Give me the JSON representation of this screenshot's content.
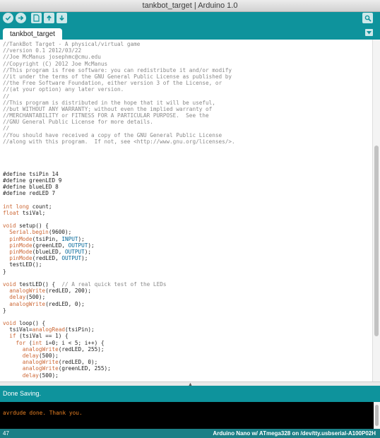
{
  "window": {
    "title": "tankbot_target | Arduino 1.0"
  },
  "toolbar": {
    "buttons": [
      {
        "name": "verify",
        "icon": "check-icon"
      },
      {
        "name": "upload",
        "icon": "arrow-right-icon"
      },
      {
        "name": "new",
        "icon": "document-icon"
      },
      {
        "name": "open",
        "icon": "arrow-up-icon"
      },
      {
        "name": "save",
        "icon": "arrow-down-icon"
      }
    ],
    "serial_monitor_icon": "magnifier-icon"
  },
  "tabs": [
    {
      "label": "tankbot_target",
      "active": true
    }
  ],
  "editor": {
    "lines": [
      {
        "type": "comment",
        "text": "//TankBot Target - A physical/virtual game"
      },
      {
        "type": "comment",
        "text": "//version 0.1 2012/03/22"
      },
      {
        "type": "comment",
        "text": "//Joe McManus josephmc@cmu.edu"
      },
      {
        "type": "comment",
        "text": "//Copyright (C) 2012 Joe McManus"
      },
      {
        "type": "comment",
        "text": "//This program is free software: you can redistribute it and/or modify"
      },
      {
        "type": "comment",
        "text": "//it under the terms of the GNU General Public License as published by"
      },
      {
        "type": "comment",
        "text": "//the Free Software Foundation, either version 3 of the License, or"
      },
      {
        "type": "comment",
        "text": "//(at your option) any later version."
      },
      {
        "type": "comment",
        "text": "//"
      },
      {
        "type": "comment",
        "text": "//This program is distributed in the hope that it will be useful,"
      },
      {
        "type": "comment",
        "text": "//but WITHOUT ANY WARRANTY; without even the implied warranty of"
      },
      {
        "type": "comment",
        "text": "//MERCHANTABILITY or FITNESS FOR A PARTICULAR PURPOSE.  See the"
      },
      {
        "type": "comment",
        "text": "//GNU General Public License for more details."
      },
      {
        "type": "comment",
        "text": "//"
      },
      {
        "type": "comment",
        "text": "//You should have received a copy of the GNU General Public License"
      },
      {
        "type": "comment",
        "text": "//along with this program.  If not, see <http://www.gnu.org/licenses/>."
      },
      {
        "type": "blank",
        "text": ""
      },
      {
        "type": "blank",
        "text": ""
      },
      {
        "type": "blank",
        "text": ""
      },
      {
        "type": "blank",
        "text": ""
      },
      {
        "type": "plain",
        "text": "#define tsiPin 14"
      },
      {
        "type": "plain",
        "text": "#define greenLED 9"
      },
      {
        "type": "plain",
        "text": "#define blueLED 8"
      },
      {
        "type": "plain",
        "text": "#define redLED 7"
      },
      {
        "type": "blank",
        "text": ""
      },
      {
        "type": "plain",
        "text": "int long count;"
      },
      {
        "type": "plain",
        "text": "float tsiVal;"
      },
      {
        "type": "blank",
        "text": ""
      },
      {
        "type": "plain",
        "text": "void setup() {"
      },
      {
        "type": "plain",
        "text": "  Serial.begin(9600);"
      },
      {
        "type": "plain",
        "text": "  pinMode(tsiPin, INPUT);"
      },
      {
        "type": "plain",
        "text": "  pinMode(greenLED, OUTPUT);"
      },
      {
        "type": "plain",
        "text": "  pinMode(blueLED, OUTPUT);"
      },
      {
        "type": "plain",
        "text": "  pinMode(redLED, OUTPUT);"
      },
      {
        "type": "plain",
        "text": "  testLED();"
      },
      {
        "type": "plain",
        "text": "}"
      },
      {
        "type": "blank",
        "text": ""
      },
      {
        "type": "plain",
        "text": "void testLED() {  // A real quick test of the LEDs"
      },
      {
        "type": "plain",
        "text": "  analogWrite(redLED, 200);"
      },
      {
        "type": "plain",
        "text": "  delay(500);"
      },
      {
        "type": "plain",
        "text": "  analogWrite(redLED, 0);"
      },
      {
        "type": "plain",
        "text": "}"
      },
      {
        "type": "blank",
        "text": ""
      },
      {
        "type": "plain",
        "text": "void loop() {"
      },
      {
        "type": "plain",
        "text": "  tsiVal=analogRead(tsiPin);"
      },
      {
        "type": "plain",
        "text": "  if (tsiVal == 1) {"
      },
      {
        "type": "plain",
        "text": "    for (int i=0; i < 5; i++) {"
      },
      {
        "type": "plain",
        "text": "      analogWrite(redLED, 255);"
      },
      {
        "type": "plain",
        "text": "      delay(500);"
      },
      {
        "type": "plain",
        "text": "      analogWrite(redLED, 0);"
      },
      {
        "type": "plain",
        "text": "      analogWrite(greenLED, 255);"
      },
      {
        "type": "plain",
        "text": "      delay(500);"
      }
    ],
    "keywords": [
      "int",
      "long",
      "float",
      "void",
      "for",
      "if"
    ],
    "functions": [
      "Serial.begin",
      "pinMode",
      "analogWrite",
      "analogRead",
      "delay"
    ],
    "constants": [
      "INPUT",
      "OUTPUT"
    ]
  },
  "status": {
    "message": "Done Saving."
  },
  "console": {
    "text": "avrdude done.  Thank you."
  },
  "footer": {
    "line_number": "47",
    "board": "Arduino Nano w/ ATmega328 on /dev/tty.usbserial-A100P02H"
  },
  "colors": {
    "teal": "#0e939c",
    "comment": "#8a8a8a",
    "keyword": "#cc6633",
    "constant": "#006699",
    "console_text": "#e67e22"
  }
}
